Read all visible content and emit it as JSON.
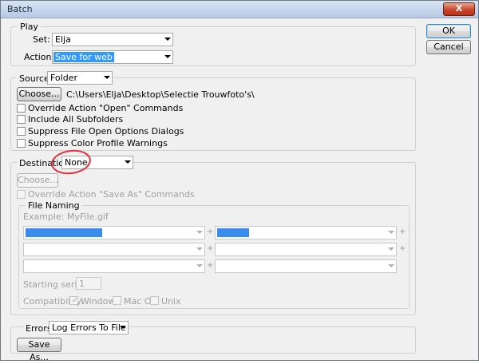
{
  "window": {
    "title": "Batch",
    "close_label": "X"
  },
  "buttons": {
    "ok": "OK",
    "cancel": "Cancel"
  },
  "play": {
    "legend": "Play",
    "set_label": "Set:",
    "set_value": "Elja",
    "action_label": "Action:",
    "action_value": "Save for web"
  },
  "source": {
    "label": "Source:",
    "value": "Folder",
    "choose_label": "Choose...",
    "path": "C:\\Users\\Elja\\Desktop\\Selectie Trouwfoto's\\",
    "options": [
      {
        "label": "Override Action \"Open\" Commands",
        "checked": false
      },
      {
        "label": "Include All Subfolders",
        "checked": false
      },
      {
        "label": "Suppress File Open Options Dialogs",
        "checked": false
      },
      {
        "label": "Suppress Color Profile Warnings",
        "checked": false
      }
    ]
  },
  "destination": {
    "label": "Destination:",
    "value": "None",
    "choose_label": "Choose...",
    "override_label": "Override Action \"Save As\" Commands",
    "file_naming": {
      "legend": "File Naming",
      "example": "Example: MyFile.gif",
      "plus": "+",
      "serial_label": "Starting serial#:",
      "serial_value": "1",
      "compat_label": "Compatibility:",
      "compat_options": [
        {
          "label": "Windows",
          "checked": true
        },
        {
          "label": "Mac OS",
          "checked": false
        },
        {
          "label": "Unix",
          "checked": false
        }
      ]
    }
  },
  "errors": {
    "label": "Errors:",
    "value": "Log Errors To File",
    "save_as_label": "Save As..."
  }
}
